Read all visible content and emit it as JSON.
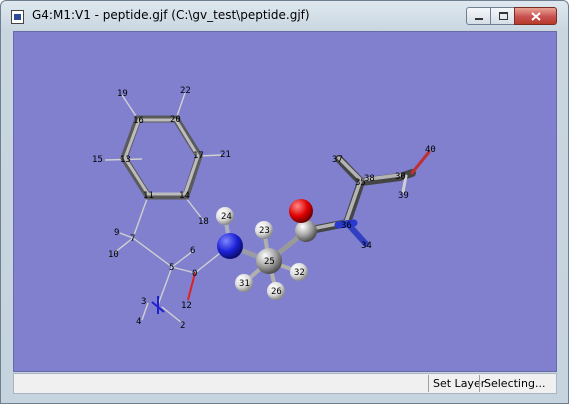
{
  "window": {
    "title": "G4:M1:V1 - peptide.gjf (C:\\gv_test\\peptide.gjf)",
    "buttons": [
      "minimize",
      "maximize",
      "close"
    ]
  },
  "viewer": {
    "background": "#8080cf",
    "atom_labels": [
      "19",
      "22",
      "16",
      "20",
      "15",
      "13",
      "17",
      "21",
      "11",
      "14",
      "18",
      "24",
      "9",
      "7",
      "6",
      "10",
      "5",
      "0",
      "3",
      "4",
      "2",
      "12",
      "23",
      "25",
      "31",
      "26",
      "32",
      "37",
      "35",
      "38",
      "30",
      "40",
      "39",
      "36",
      "34"
    ]
  },
  "statusbar": {
    "left": "",
    "layer": "Set Layer",
    "mode": "Selecting..."
  },
  "colors": {
    "oxygen": "#e00000",
    "nitrogen": "#1c22d8",
    "carbon": "#a8a8a8",
    "hydrogen": "#eeeeee"
  }
}
